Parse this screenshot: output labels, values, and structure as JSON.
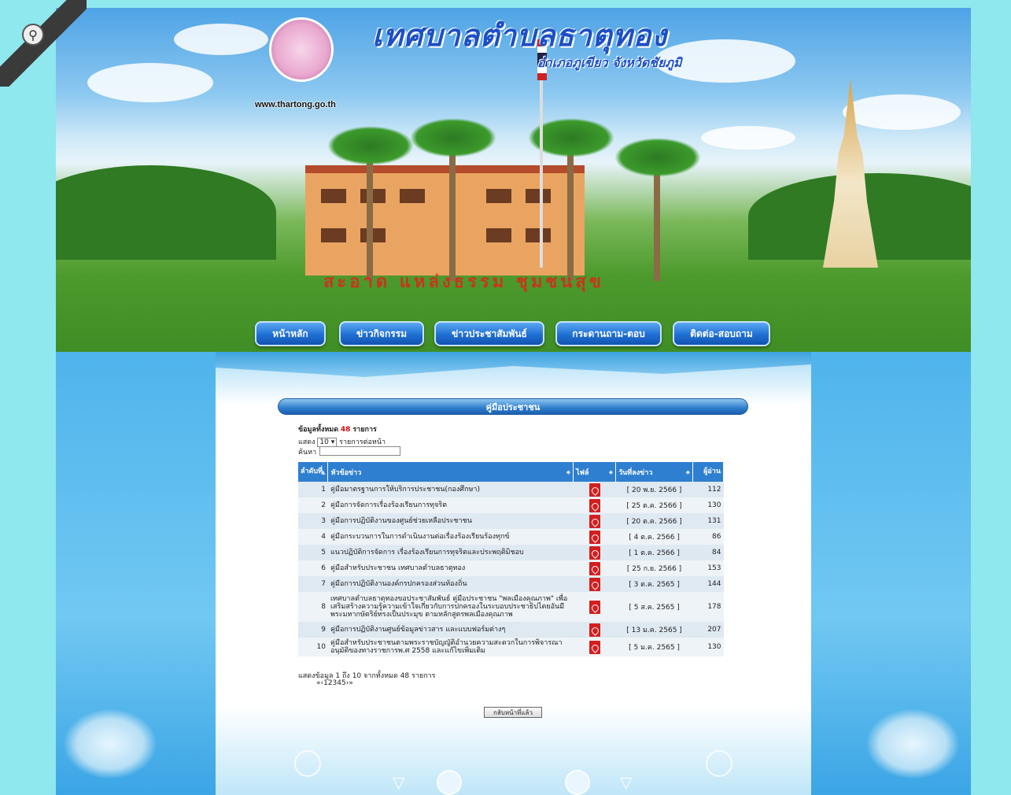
{
  "header": {
    "site_title": "เทศบาลตำบลธาตุทอง",
    "site_subtitle": "อำเภอภูเขียว จังหวัดชัยภูมิ",
    "site_url": "www.thartong.go.th",
    "motto": "สะอาด แหล่งธรรม ชุมชนสุข"
  },
  "nav": {
    "items": [
      {
        "label": "หน้าหลัก"
      },
      {
        "label": "ข่าวกิจกรรม"
      },
      {
        "label": "ข่าวประชาสัมพันธ์"
      },
      {
        "label": "กระดานถาม-ตอบ"
      },
      {
        "label": "ติดต่อ-สอบถาม"
      }
    ]
  },
  "section": {
    "title": "คู่มือประชาชน",
    "total_prefix": "ข้อมูลทั้งหมด",
    "total_count": "48",
    "total_suffix": "รายการ",
    "show_prefix": "แสดง",
    "page_size": "10",
    "show_suffix": "รายการต่อหน้า",
    "search_label": "ค้นหา",
    "search_value": ""
  },
  "table": {
    "headers": {
      "num": "ลำดับที่",
      "title": "หัวข้อข่าว",
      "file": "ไฟล์",
      "date": "วันที่ลงข่าว",
      "views": "ผู้อ่าน"
    },
    "rows": [
      {
        "num": "1",
        "title": "คู่มือมาตรฐานการให้บริการประชาชน(กองศึกษา)",
        "date": "[ 20 พ.ย. 2566 ]",
        "views": "112"
      },
      {
        "num": "2",
        "title": "คู่มือการจัดการเรื่องร้องเรียนการทุจริต",
        "date": "[ 25 ต.ค. 2566 ]",
        "views": "130"
      },
      {
        "num": "3",
        "title": "คู่มือการปฏิบัติงานของศูนย์ช่วยเหลือประชาชน",
        "date": "[ 20 ต.ค. 2566 ]",
        "views": "131"
      },
      {
        "num": "4",
        "title": "คู่มือกระบวนการในการดำเนินงานต่อเรื่องร้องเรียนร้องทุกข์",
        "date": "[ 4 ต.ค. 2566 ]",
        "views": "86"
      },
      {
        "num": "5",
        "title": "แนวปฏิบัติการจัดการ เรื่องร้องเรียนการทุจริตและประพฤติมิชอบ",
        "date": "[ 1 ต.ค. 2566 ]",
        "views": "84"
      },
      {
        "num": "6",
        "title": "คู่มือสำหรับประชาชน เทศบาลตำบลธาตุทอง",
        "date": "[ 25 ก.ย. 2566 ]",
        "views": "153"
      },
      {
        "num": "7",
        "title": "คู่มือการปฏิบัติงานองค์กรปกครองส่วนท้องถิ่น",
        "date": "[ 3 ต.ค. 2565 ]",
        "views": "144"
      },
      {
        "num": "8",
        "title": "เทศบาลตำบลธาตุทองขอประชาสัมพันธ์ คู่มือประชาชน \"พลเมืองคุณภาพ\" เพื่อเสริมสร้างความรู้ความเข้าใจเกี่ยวกับการปกครองในระบอบประชาธิปไตยอันมีพระมหากษัตริย์ทรงเป็นประมุข ตามหลักสูตรพลเมืองคุณภาพ",
        "date": "[ 5 ส.ค. 2565 ]",
        "views": "178"
      },
      {
        "num": "9",
        "title": "คู่มือการปฏิบัติงานศูนย์ข้อมูลข่าวสาร และแบบฟอร์มต่างๆ",
        "date": "[ 13 ม.ค. 2565 ]",
        "views": "207"
      },
      {
        "num": "10",
        "title": "คู่มือสำหรับประชาชนตามพระราชบัญญัติอำนวยความสะดวกในการพิจารณาอนุมัติของทางราชการพ.ศ 2558 และแก้ไขเพิ่มเติม",
        "date": "[ 5 ม.ค. 2565 ]",
        "views": "130"
      }
    ]
  },
  "footer": {
    "summary": "แสดงข้อมูล 1 ถึง 10 จากทั้งหมด 48 รายการ",
    "pager": "«‹12345›»",
    "back_label": "กลับหน้าที่แล้ว"
  },
  "colors": {
    "page_bg": "#8ee8ee",
    "nav_blue": "#1f6fd3",
    "table_header": "#2e7fd0",
    "count_red": "#d01010",
    "pdf_red": "#d21f1f"
  },
  "icons": [
    "ribbon-icon",
    "pdf-icon"
  ]
}
